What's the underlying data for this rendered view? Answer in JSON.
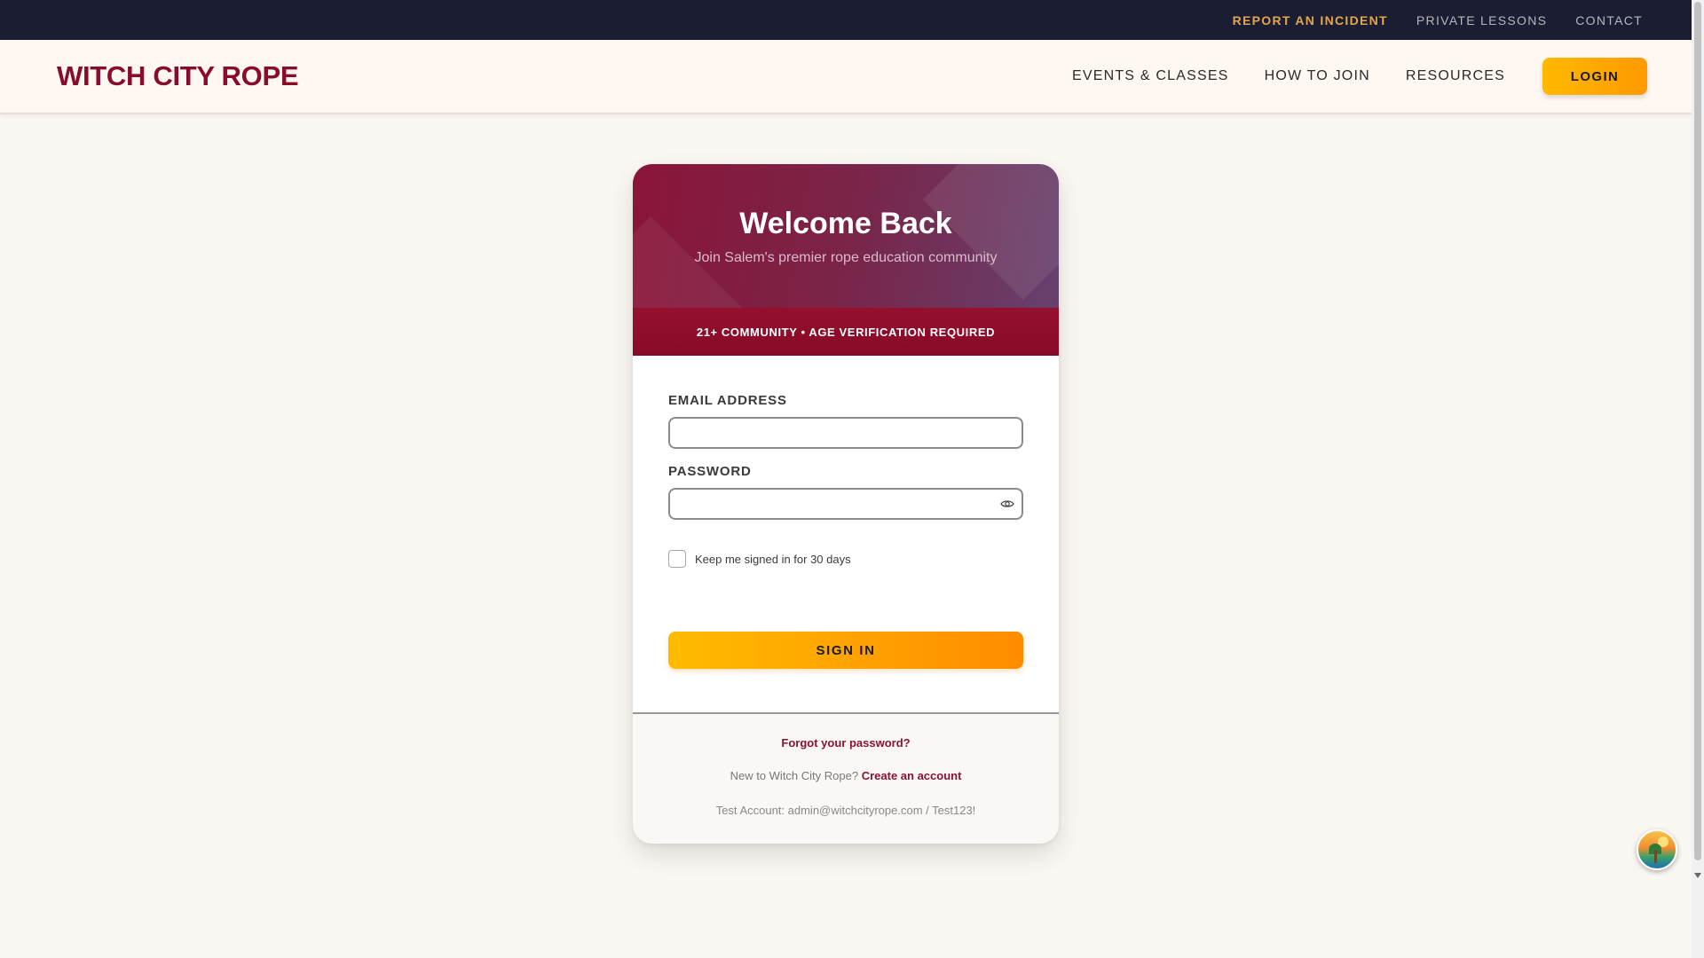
{
  "utility_nav": {
    "report": "REPORT AN INCIDENT",
    "lessons": "PRIVATE LESSONS",
    "contact": "CONTACT"
  },
  "header": {
    "logo": "WITCH CITY ROPE",
    "nav": {
      "events": "EVENTS & CLASSES",
      "join": "HOW TO JOIN",
      "resources": "RESOURCES"
    },
    "login_label": "LOGIN"
  },
  "card": {
    "title": "Welcome Back",
    "subtitle": "Join Salem's premier rope education community",
    "age_banner": "21+ COMMUNITY • AGE VERIFICATION REQUIRED",
    "email_label": "EMAIL ADDRESS",
    "email_value": "",
    "password_label": "PASSWORD",
    "password_value": "",
    "remember_label": "Keep me signed in for 30 days",
    "remember_checked": false,
    "signin_label": "SIGN IN",
    "forgot_label": "Forgot your password?",
    "new_prefix": "New to Witch City Rope? ",
    "create_label": "Create an account",
    "test_account": "Test Account: admin@witchcityrope.com / Test123!"
  },
  "colors": {
    "brand": "#880d2a",
    "accent": "#ffb800",
    "utility_bg": "#1b1e33",
    "incident": "#e3a64f"
  },
  "icons": {
    "password_toggle": "eye-icon",
    "floating_widget": "palm-sunset-icon"
  }
}
